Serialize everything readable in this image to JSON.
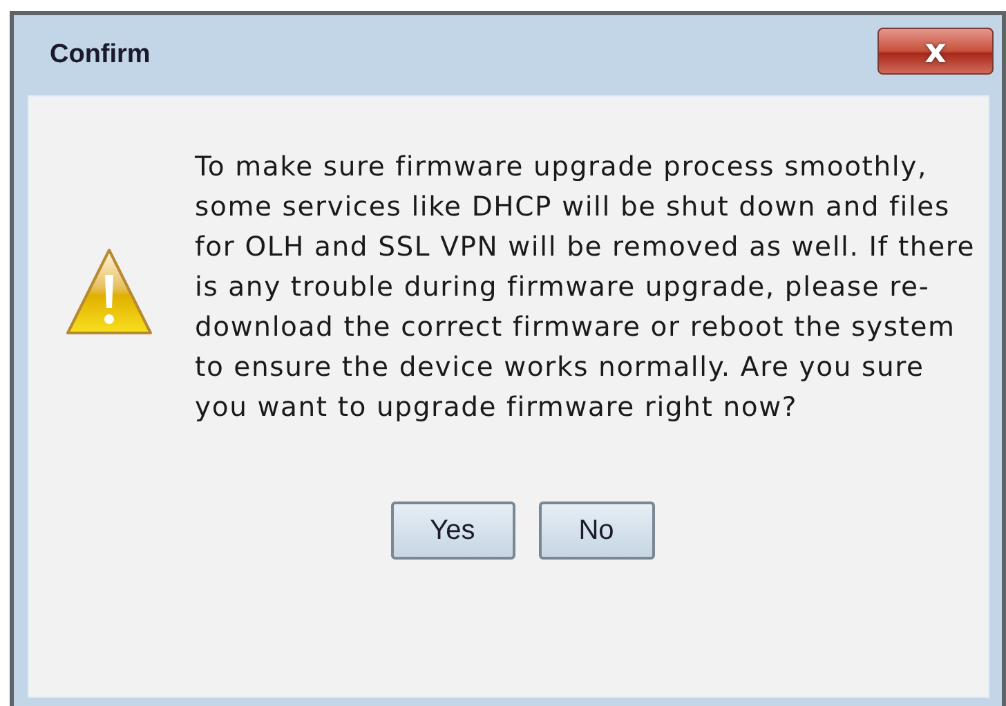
{
  "window": {
    "title": "Confirm",
    "close_glyph": "x"
  },
  "message": "To make sure firmware upgrade process smoothly, some services like DHCP will be shut down and files for OLH and SSL VPN will be removed as well. If there is any trouble during firmware upgrade, please re-download the correct firmware or reboot the system to ensure the device works normally. Are you sure you want to upgrade firmware right now?",
  "buttons": [
    "Yes",
    "No"
  ]
}
